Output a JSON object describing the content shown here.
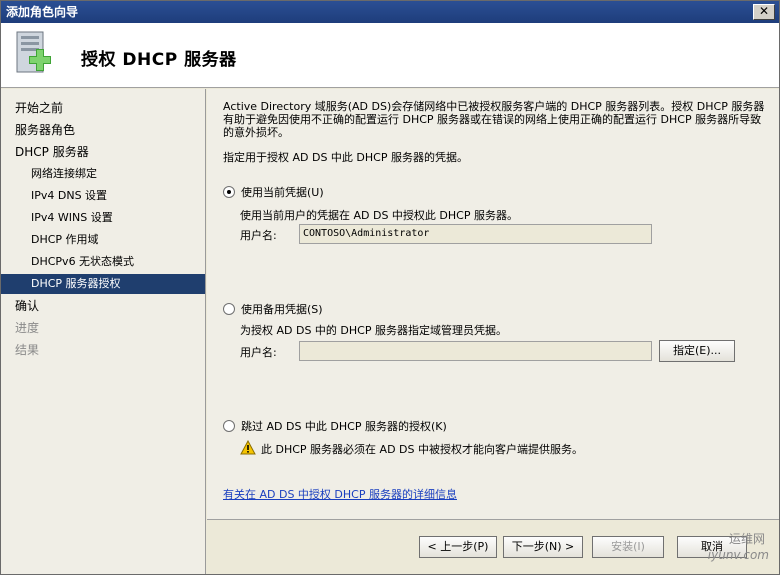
{
  "window": {
    "title": "添加角色向导",
    "close_label": "✕"
  },
  "header": {
    "title": "授权 DHCP 服务器"
  },
  "nav": {
    "items": [
      {
        "label": "开始之前"
      },
      {
        "label": "服务器角色"
      },
      {
        "label": "DHCP 服务器"
      },
      {
        "label": "网络连接绑定"
      },
      {
        "label": "IPv4 DNS 设置"
      },
      {
        "label": "IPv4 WINS 设置"
      },
      {
        "label": "DHCP 作用域"
      },
      {
        "label": "DHCPv6 无状态模式"
      },
      {
        "label": "DHCP 服务器授权"
      },
      {
        "label": "确认"
      },
      {
        "label": "进度"
      },
      {
        "label": "结果"
      }
    ]
  },
  "content": {
    "description": "Active Directory 域服务(AD DS)会存储网络中已被授权服务客户端的 DHCP 服务器列表。授权 DHCP 服务器有助于避免因使用不正确的配置运行 DHCP 服务器或在错误的网络上使用正确的配置运行 DHCP 服务器所导致的意外损坏。",
    "instruction": "指定用于授权 AD DS 中此 DHCP 服务器的凭据。",
    "option_current": {
      "label": "使用当前凭据(U)",
      "description": "使用当前用户的凭据在 AD DS 中授权此 DHCP 服务器。",
      "username_label": "用户名:",
      "username_value": "CONTOSO\\Administrator"
    },
    "option_alternate": {
      "label": "使用备用凭据(S)",
      "description": "为授权 AD DS 中的 DHCP 服务器指定域管理员凭据。",
      "username_label": "用户名:",
      "username_value": "",
      "specify_button": "指定(E)..."
    },
    "option_skip": {
      "label": "跳过 AD DS 中此 DHCP 服务器的授权(K)",
      "warning": "此 DHCP 服务器必须在 AD DS 中被授权才能向客户端提供服务。"
    },
    "link": "有关在 AD DS 中授权 DHCP 服务器的详细信息"
  },
  "footer": {
    "back": "< 上一步(P)",
    "next": "下一步(N) >",
    "install": "安装(I)",
    "cancel": "取消"
  },
  "watermark": {
    "line1": "运维网",
    "line2": "iyunv.com"
  }
}
